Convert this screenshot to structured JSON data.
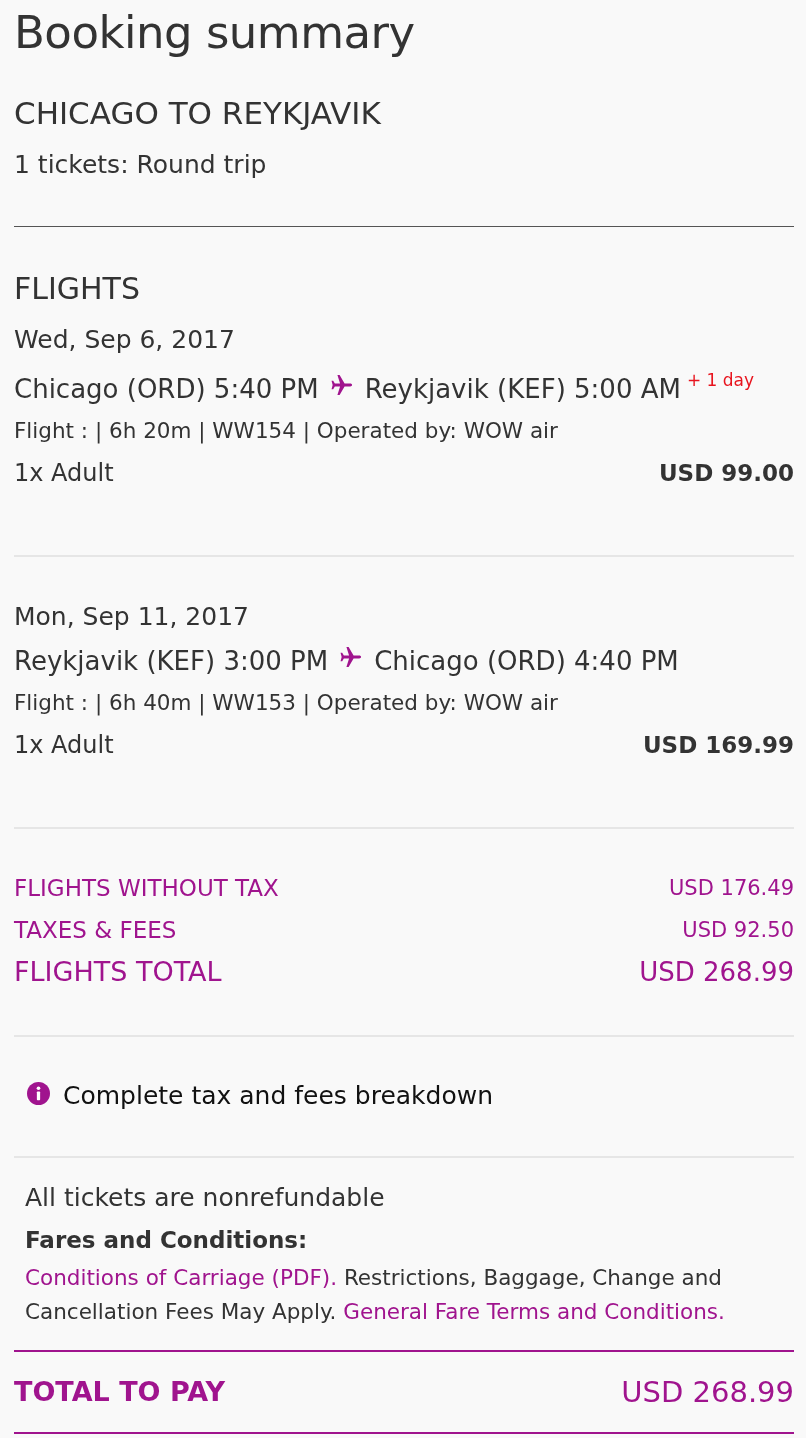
{
  "title": "Booking summary",
  "trip": {
    "route": "CHICAGO TO REYKJAVIK",
    "tickets": "1 tickets: Round trip"
  },
  "flights": {
    "heading": "FLIGHTS",
    "legs": [
      {
        "date": "Wed, Sep 6, 2017",
        "from": "Chicago (ORD) 5:40 PM",
        "to": "Reykjavik (KEF) 5:00 AM",
        "day_offset": "+ 1 day",
        "info": "Flight : | 6h 20m | WW154 | Operated by: WOW air",
        "passengers": "1x Adult",
        "price": "USD 99.00"
      },
      {
        "date": "Mon, Sep 11, 2017",
        "from": "Reykjavik (KEF) 3:00 PM",
        "to": "Chicago (ORD) 4:40 PM",
        "info": "Flight : | 6h 40m | WW153 | Operated by: WOW air",
        "passengers": "1x Adult",
        "price": "USD 169.99"
      }
    ]
  },
  "totals": [
    {
      "kind": "subtotal",
      "label": "FLIGHTS WITHOUT TAX",
      "amount": "USD 176.49"
    },
    {
      "kind": "subtotal",
      "label": "TAXES & FEES",
      "amount": "USD 92.50"
    },
    {
      "kind": "total",
      "label": "FLIGHTS TOTAL",
      "amount": "USD 268.99"
    }
  ],
  "breakdown_link": "Complete tax and fees breakdown",
  "conditions": {
    "note": "All tickets are nonrefundable",
    "heading": "Fares and Conditions:",
    "paragraph": [
      {
        "kind": "link",
        "text": "Conditions of Carriage (PDF)."
      },
      {
        "kind": "text",
        "text": " Restrictions, Baggage, Change and Cancellation Fees May Apply. "
      },
      {
        "kind": "link",
        "text": "General Fare Terms and Conditions."
      }
    ]
  },
  "total_to_pay": {
    "label": "TOTAL TO PAY",
    "amount": "USD 268.99"
  }
}
